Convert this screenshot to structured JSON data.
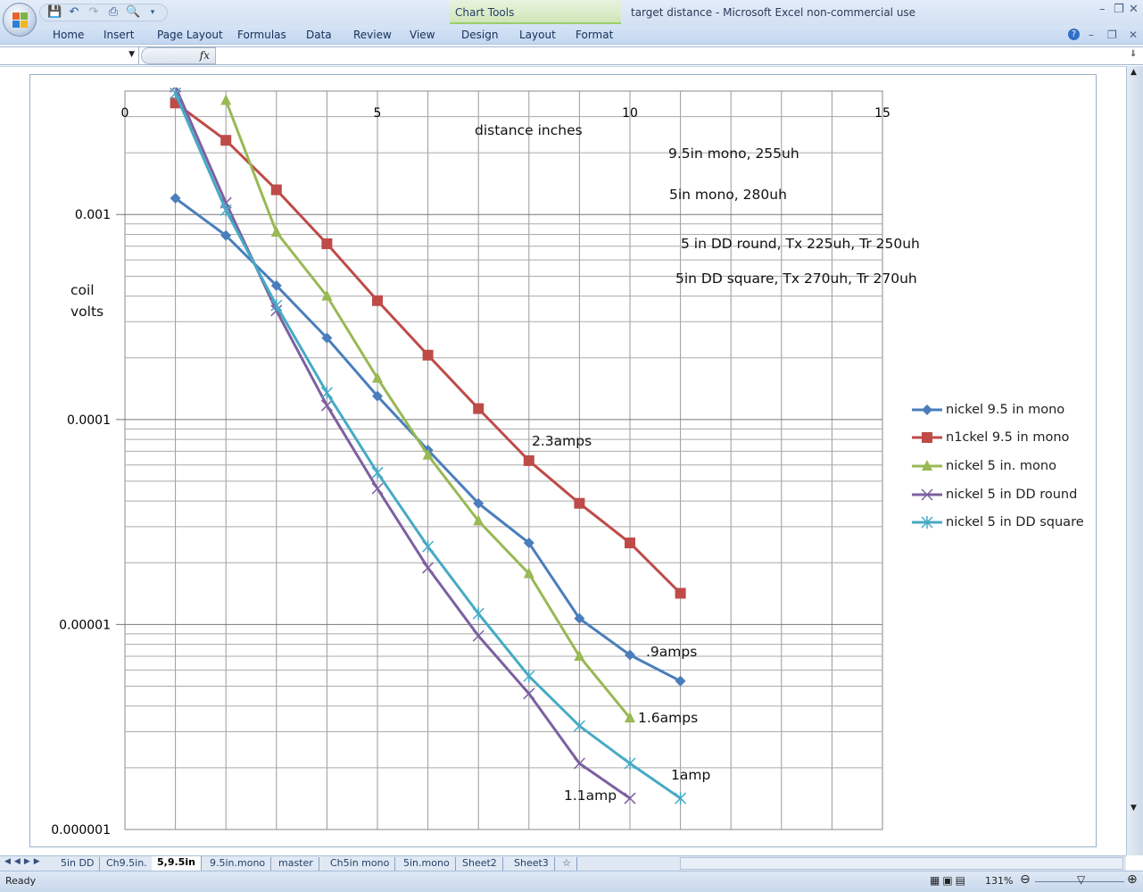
{
  "window": {
    "title": "target distance - Microsoft Excel non-commercial use",
    "context_tab_group": "Chart Tools"
  },
  "ribbon": {
    "tabs": [
      "Home",
      "Insert",
      "Page Layout",
      "Formulas",
      "Data",
      "Review",
      "View",
      "Design",
      "Layout",
      "Format"
    ]
  },
  "formula_bar": {
    "name_box": "",
    "fx_label": "fx",
    "formula": ""
  },
  "sheet_tabs": [
    "5in DD",
    "Ch9.5in.",
    "5,9.5in",
    "9.5in.mono",
    "master",
    "Ch5in mono",
    "5in.mono",
    "Sheet2",
    "Sheet3"
  ],
  "active_sheet": "5,9.5in",
  "status": {
    "text": "Ready",
    "zoom": "131%"
  },
  "chart_data": {
    "type": "scatter",
    "title": "",
    "xlabel": "distance inches",
    "ylabel": "coil volts",
    "xlim": [
      0,
      15
    ],
    "ylim": [
      1e-06,
      0.004
    ],
    "yscale": "log",
    "x_ticks": [
      "0",
      "5",
      "10",
      "15"
    ],
    "y_ticks": [
      "0.001",
      "0.0001",
      "0.00001",
      "0.000001"
    ],
    "grid": true,
    "legend_position": "right",
    "series": [
      {
        "name": "nickel 9.5 in mono",
        "color": "#4a7ebb",
        "marker": "diamond",
        "x": [
          1,
          2,
          3,
          4,
          5,
          6,
          7,
          8,
          9,
          10,
          11
        ],
        "values": [
          0.0012,
          0.00079,
          0.00045,
          0.00025,
          0.00013,
          7.1e-05,
          3.9e-05,
          2.5e-05,
          1.07e-05,
          7.1e-06,
          5.3e-06
        ]
      },
      {
        "name": "n1ckel 9.5 in mono",
        "color": "#be4b48",
        "marker": "square",
        "x": [
          1,
          2,
          3,
          4,
          5,
          6,
          7,
          8,
          9,
          10,
          11
        ],
        "values": [
          0.0035,
          0.0023,
          0.00132,
          0.00072,
          0.00038,
          0.000206,
          0.000113,
          6.3e-05,
          3.9e-05,
          2.5e-05,
          1.42e-05
        ]
      },
      {
        "name": "nickel 5 in. mono",
        "color": "#98b954",
        "marker": "triangle",
        "x": [
          2,
          3,
          4,
          5,
          6,
          7,
          8,
          9,
          10
        ],
        "values": [
          0.0036,
          0.00082,
          0.0004,
          0.000159,
          6.7e-05,
          3.2e-05,
          1.77e-05,
          7e-06,
          3.5e-06
        ]
      },
      {
        "name": "nickel 5 in DD round",
        "color": "#7d60a0",
        "marker": "x",
        "x": [
          1,
          2,
          3,
          4,
          5,
          6,
          7,
          8,
          9,
          10
        ],
        "values": [
          0.0042,
          0.00114,
          0.00034,
          0.000117,
          4.6e-05,
          1.89e-05,
          8.8e-06,
          4.6e-06,
          2.1e-06,
          1.42e-06
        ]
      },
      {
        "name": "nickel 5 in DD square",
        "color": "#46aac5",
        "marker": "star",
        "x": [
          1,
          2,
          3,
          4,
          5,
          6,
          7,
          8,
          9,
          10,
          11
        ],
        "values": [
          0.0039,
          0.00105,
          0.00036,
          0.000135,
          5.5e-05,
          2.4e-05,
          1.13e-05,
          5.6e-06,
          3.2e-06,
          2.1e-06,
          1.42e-06
        ]
      }
    ],
    "annotations": [
      "9.5in mono, 255uh",
      "5in mono, 280uh",
      "5 in DD round, Tx 225uh, Tr 250uh",
      "5in DD square, Tx 270uh, Tr 270uh",
      "2.3amps",
      ".9amps",
      "1.6amps",
      "1amp",
      "1.1amp"
    ]
  }
}
